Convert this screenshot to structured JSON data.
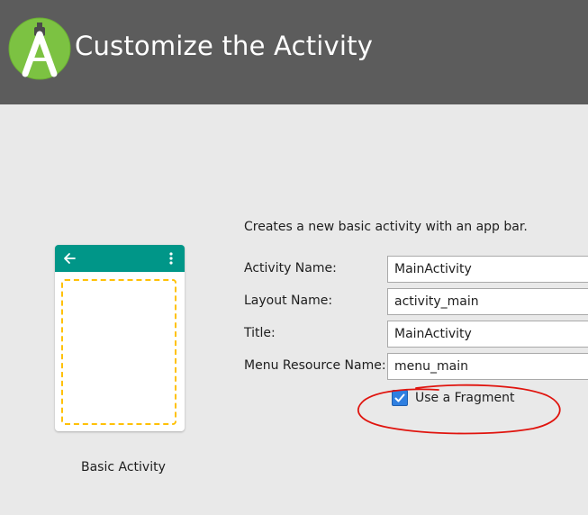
{
  "header": {
    "title": "Customize the Activity",
    "logo_icon": "android-studio-logo-icon"
  },
  "template": {
    "name": "Basic Activity",
    "appbar_color": "#009688",
    "fragment_color": "#ffc107"
  },
  "form": {
    "description": "Creates a new basic activity with an app bar.",
    "fields": [
      {
        "label": "Activity Name:",
        "value": "MainActivity"
      },
      {
        "label": "Layout Name:",
        "value": "activity_main"
      },
      {
        "label": "Title:",
        "value": "MainActivity"
      },
      {
        "label": "Menu Resource Name:",
        "value": "menu_main"
      }
    ],
    "fragment_checkbox": {
      "label": "Use a Fragment",
      "checked": true
    }
  },
  "annotation_color": "#e0140e"
}
